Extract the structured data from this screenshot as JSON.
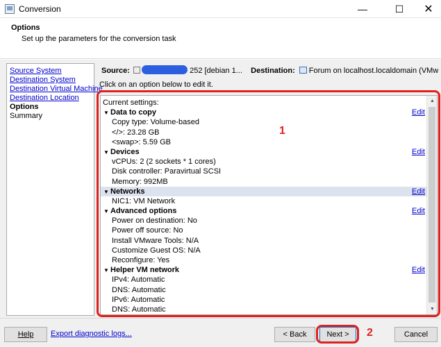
{
  "window": {
    "title": "Conversion",
    "minimize_glyph": "—",
    "maximize_glyph": "☐",
    "close_glyph": "✕"
  },
  "header": {
    "title": "Options",
    "subtitle": "Set up the parameters for the conversion task"
  },
  "nav": {
    "items": [
      {
        "label": "Source System"
      },
      {
        "label": "Destination System"
      },
      {
        "label": "Destination Virtual Machine"
      },
      {
        "label": "Destination Location"
      },
      {
        "label": "Options"
      },
      {
        "label": "Summary"
      }
    ]
  },
  "source_dest": {
    "source_label": "Source:",
    "source_value": "252 [debian 1...",
    "destination_label": "Destination:",
    "destination_value": "Forum on localhost.localdomain (VMware ES..."
  },
  "hint": "Click on an option below to edit it.",
  "settings": {
    "heading": "Current settings:",
    "edit_label": "Edit",
    "sections": [
      {
        "title": "Data to copy",
        "items": [
          "Copy type: Volume-based",
          "</>: 23.28 GB",
          "<swap>: 5.59 GB"
        ]
      },
      {
        "title": "Devices",
        "items": [
          "vCPUs: 2 (2 sockets * 1 cores)",
          "Disk controller: Paravirtual SCSI",
          "Memory: 992MB"
        ]
      },
      {
        "title": "Networks",
        "items": [
          "NIC1: VM Network"
        ]
      },
      {
        "title": "Advanced options",
        "items": [
          "Power on destination: No",
          "Power off source: No",
          "Install VMware Tools: N/A",
          "Customize Guest OS: N/A",
          "Reconfigure: Yes"
        ]
      },
      {
        "title": "Helper VM network",
        "items": [
          "IPv4: Automatic",
          "DNS: Automatic",
          "IPv6: Automatic",
          "DNS: Automatic"
        ]
      }
    ]
  },
  "annotations": {
    "one": "1",
    "two": "2",
    "color": "#e02020"
  },
  "footer": {
    "help": "Help",
    "export_link": "Export diagnostic logs...",
    "back": "< Back",
    "next": "Next >",
    "cancel": "Cancel"
  },
  "colors": {
    "link": "#0000cc",
    "highlight_row": "#dde3ee",
    "redaction": "#2b5fe0"
  }
}
